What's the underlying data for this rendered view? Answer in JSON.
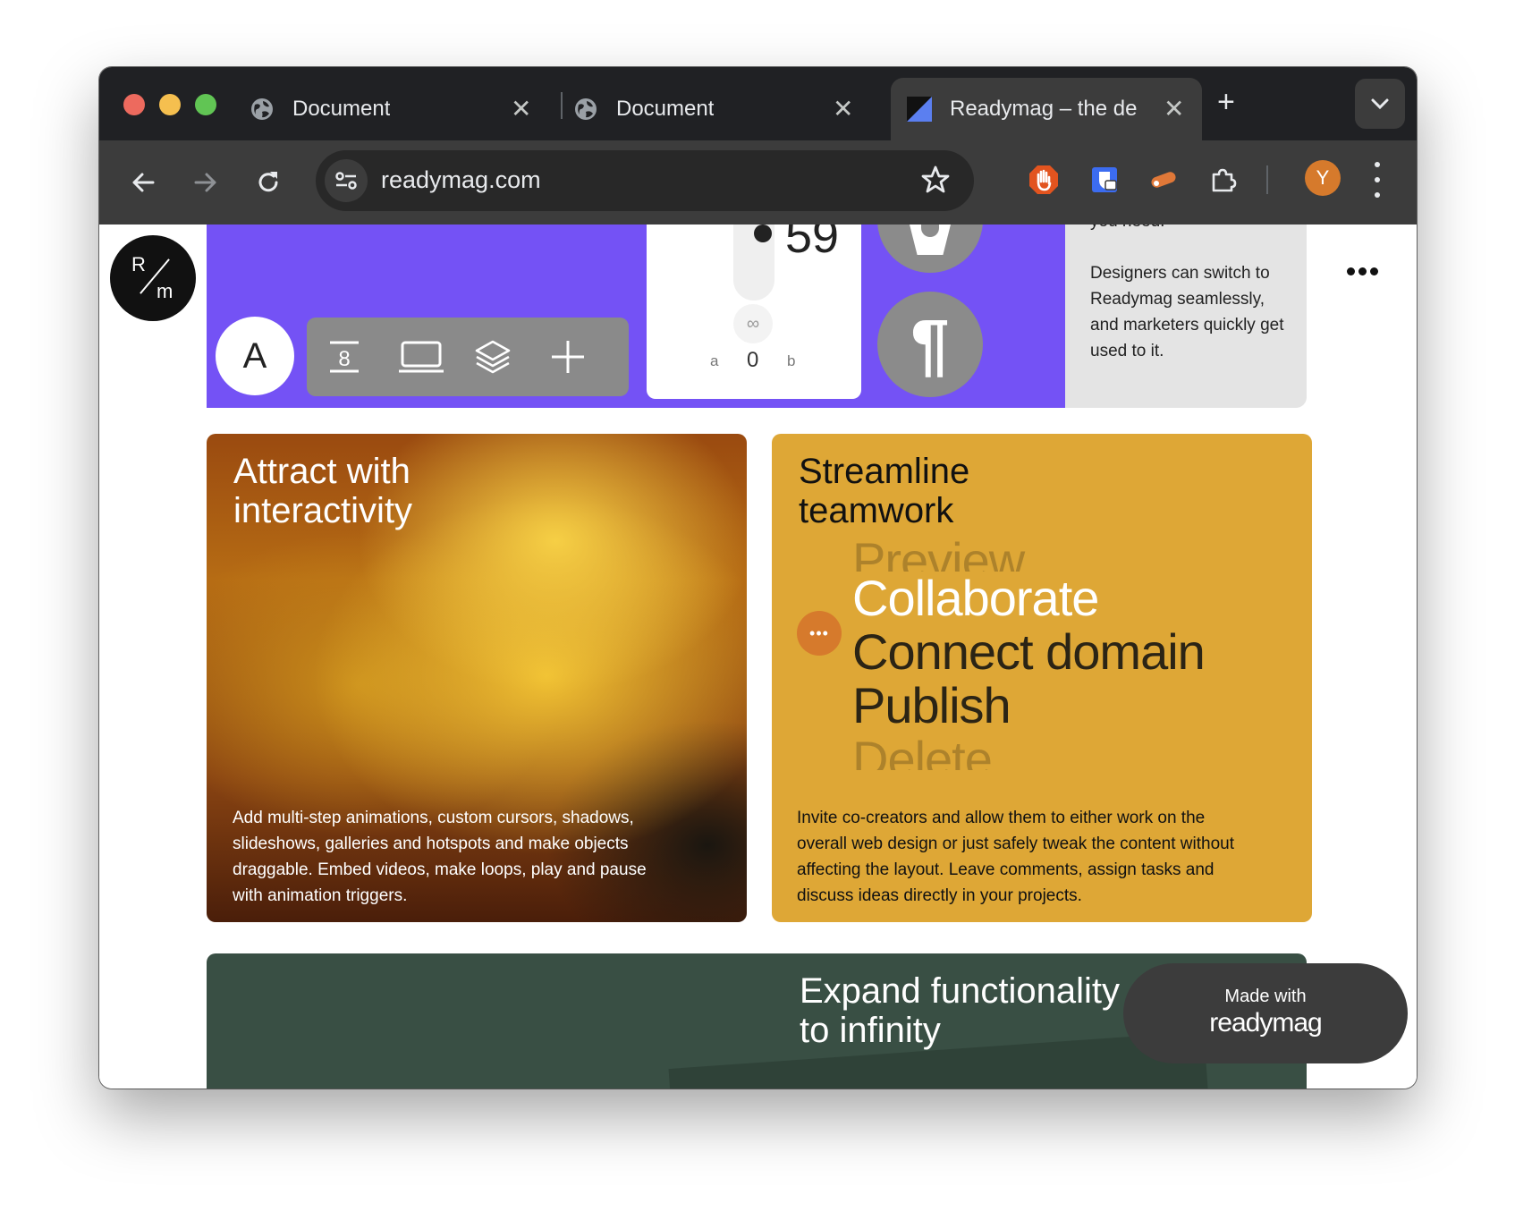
{
  "browser": {
    "tabs": [
      {
        "title": "Document",
        "icon": "globe-icon"
      },
      {
        "title": "Document",
        "icon": "globe-icon"
      },
      {
        "title": "Readymag – the de",
        "icon": "readymag-favicon",
        "active": true
      }
    ],
    "url": "readymag.com",
    "profile_initial": "Y",
    "colors": {
      "tabbar": "#202124",
      "toolbar": "#3c3c3c",
      "avatar": "#d67a2c"
    }
  },
  "page": {
    "logo": {
      "top": "R",
      "bottom": "m"
    },
    "editor_demo": {
      "text_button": "A",
      "counter_value": "59",
      "infinity": "∞",
      "range_a": "a",
      "range_value": "0",
      "range_b": "b",
      "paragraph_symbol": "¶",
      "accent": "#7452f5"
    },
    "switch_panel": {
      "cut_text": "you need.",
      "text": "Designers can switch to Readymag seamlessly, and marketers quickly get used to it."
    },
    "attract": {
      "title": "Attract with interactivity",
      "body": "Add multi-step animations, custom cursors, shadows, slideshows, galleries and hotspots and make objects draggable. Embed videos, make loops, play and pause with animation triggers."
    },
    "teamwork": {
      "title": "Streamline teamwork",
      "steps": [
        "Preview",
        "Collaborate",
        "Connect domain",
        "Publish",
        "Delete"
      ],
      "dots": "•••",
      "body": "Invite co-creators and allow them to either work on the overall web design or just safely tweak the content without affecting the layout. Leave comments, assign tasks and discuss ideas directly in your projects.",
      "accent": "#dea736"
    },
    "expand": {
      "title_line1": "Expand functionality",
      "title_line2": "to infinity",
      "accent": "#394f44"
    },
    "made_with": {
      "line1": "Made with",
      "line2": "readymag"
    }
  }
}
